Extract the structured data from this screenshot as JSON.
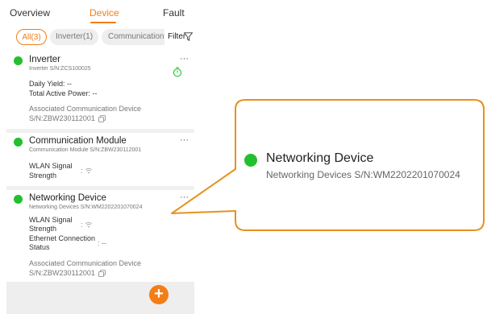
{
  "tabs": [
    {
      "label": "Overview"
    },
    {
      "label": "Device"
    },
    {
      "label": "Fault"
    }
  ],
  "active_tab": "Device",
  "filters": {
    "chips": [
      {
        "label": "All(3)"
      },
      {
        "label": "Inverter(1)"
      },
      {
        "label": "Communication M"
      }
    ],
    "filter_label": "Filter"
  },
  "devices": [
    {
      "name": "Inverter",
      "sn": "Inverter S/N:ZCS100025",
      "status_color": "#22c02e",
      "daily_yield": "Daily Yield: --",
      "total_active_power": "Total Active Power: --",
      "assoc_label": "Associated Communication Device",
      "assoc_sn": "S/N:ZBW230112001",
      "more": "···"
    },
    {
      "name": "Communication Module",
      "sn": "Communication Module S/N:ZBW230112001",
      "status_color": "#22c02e",
      "wlan_label_1": "WLAN Signal",
      "wlan_label_2": "Strength",
      "wlan_sep": ":",
      "more": "···"
    },
    {
      "name": "Networking Device",
      "sn": "Networking Devices S/N:WM2202201070024",
      "status_color": "#22c02e",
      "wlan_label_1": "WLAN Signal",
      "wlan_label_2": "Strength",
      "wlan_sep": ":",
      "eth_label_1": "Ethernet Connection",
      "eth_label_2": "Status",
      "eth_value": ": --",
      "assoc_label": "Associated Communication Device",
      "assoc_sn": "S/N:ZBW230112001",
      "more": "···"
    }
  ],
  "fab_label": "+",
  "callout": {
    "title": "Networking Device",
    "subtitle": "Networking Devices S/N:WM2202201070024",
    "border_color": "#e8901c",
    "dot_color": "#22c02e"
  },
  "colors": {
    "accent": "#f07d1a",
    "status_online": "#22c02e"
  }
}
